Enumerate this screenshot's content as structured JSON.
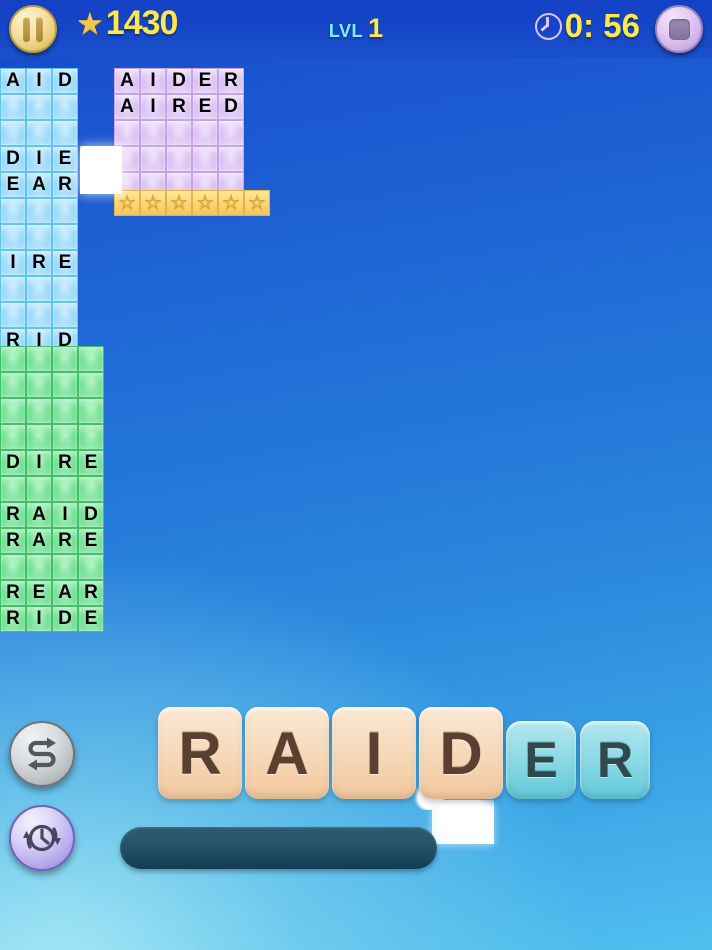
{
  "hud": {
    "pause_icon": "pause-icon",
    "stop_icon": "stop-icon",
    "star_glyph": "★",
    "score": "1430",
    "level_label": "LVL",
    "level_value": "1",
    "clock_icon": "clock-icon",
    "timer": "0: 56",
    "colors": {
      "score_yellow": "#ffe84a",
      "level_cyan": "#7df0ff",
      "topbar_blue": "#1647c8"
    }
  },
  "boards": {
    "blue": {
      "name": "three-letter-board",
      "columns": 3,
      "rows": [
        [
          "A",
          "I",
          "D"
        ],
        [
          "",
          "",
          ""
        ],
        [
          "",
          "",
          ""
        ],
        [
          "D",
          "I",
          "E"
        ],
        [
          "E",
          "A",
          "R"
        ],
        [
          "",
          "",
          ""
        ],
        [
          "",
          "",
          ""
        ],
        [
          "I",
          "R",
          "E"
        ],
        [
          "",
          "",
          ""
        ],
        [
          "",
          "",
          ""
        ],
        [
          "R",
          "I",
          "D"
        ]
      ]
    },
    "green": {
      "name": "four-letter-board",
      "columns": 4,
      "rows": [
        [
          "",
          "",
          "",
          ""
        ],
        [
          "",
          "",
          "",
          ""
        ],
        [
          "",
          "",
          "",
          ""
        ],
        [
          "",
          "",
          "",
          ""
        ],
        [
          "D",
          "I",
          "R",
          "E"
        ],
        [
          "",
          "",
          "",
          ""
        ],
        [
          "R",
          "A",
          "I",
          "D"
        ],
        [
          "R",
          "A",
          "R",
          "E"
        ],
        [
          "",
          "",
          "",
          ""
        ],
        [
          "R",
          "E",
          "A",
          "R"
        ],
        [
          "R",
          "I",
          "D",
          "E"
        ]
      ]
    },
    "purple": {
      "name": "five-letter-board",
      "columns": 5,
      "rows": [
        [
          "A",
          "I",
          "D",
          "E",
          "R"
        ],
        [
          "A",
          "I",
          "R",
          "E",
          "D"
        ],
        [
          "",
          "",
          "",
          "",
          ""
        ],
        [
          "",
          "",
          "",
          "",
          ""
        ],
        [
          "",
          "",
          "",
          "",
          ""
        ]
      ]
    },
    "star_row": {
      "name": "bonus-star-row",
      "count": 6,
      "glyph": "☆"
    }
  },
  "rack": {
    "tiles": [
      {
        "letter": "R",
        "style": "big"
      },
      {
        "letter": "A",
        "style": "big"
      },
      {
        "letter": "I",
        "style": "big"
      },
      {
        "letter": "D",
        "style": "big"
      },
      {
        "letter": "E",
        "style": "small"
      },
      {
        "letter": "R",
        "style": "small"
      }
    ]
  },
  "actions": {
    "shuffle_icon": "shuffle-icon",
    "extra_time_icon": "extra-time-icon"
  },
  "word_input": {
    "value": "",
    "placeholder": ""
  }
}
